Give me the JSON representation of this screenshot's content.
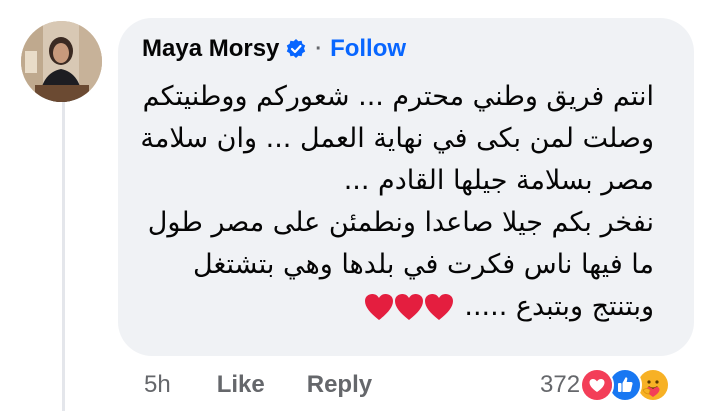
{
  "comment": {
    "author": "Maya Morsy",
    "separator": "·",
    "follow_label": "Follow",
    "lines": [
      "انتم فريق وطني محترم ... شعوركم  ووطنيتكم",
      "وصلت لمن بكى في نهاية العمل ... وان سلامة",
      "مصر بسلامة جيلها القادم ...",
      "نفخر بكم جيلا صاعدا ونطمئن على مصر طول",
      "ما فيها ناس فكرت في بلدها وهي بتشتغل",
      "وبتنتج وبتبدع ....."
    ],
    "hearts_count": 3,
    "heart_color": "#e41e3f"
  },
  "actions": {
    "time": "5h",
    "like_label": "Like",
    "reply_label": "Reply"
  },
  "reactions": {
    "count": "372",
    "icons": [
      "love-reaction-icon",
      "like-reaction-icon",
      "care-reaction-icon"
    ]
  },
  "colors": {
    "bubble": "#f0f2f5",
    "link": "#0866ff",
    "muted": "#65676b",
    "verified": "#0866ff"
  }
}
